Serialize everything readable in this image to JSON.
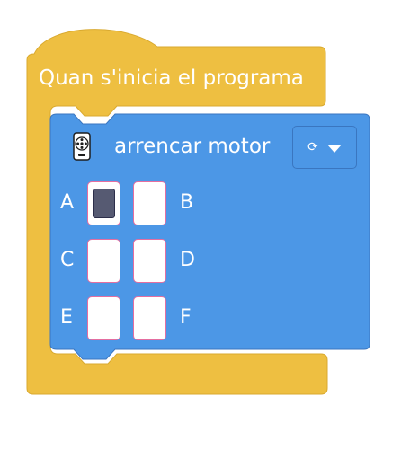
{
  "hat_block": {
    "label": "Quan s'inicia el programa",
    "color": "#eebf41"
  },
  "motor_block": {
    "label": "arrencar motor",
    "icon": "motor-icon",
    "color": "#4c97e6",
    "direction_dropdown": {
      "icon": "rotate-clockwise-icon",
      "glyph": "⟳"
    }
  },
  "ports": [
    {
      "name": "A",
      "selected": true
    },
    {
      "name": "B",
      "selected": false
    },
    {
      "name": "C",
      "selected": false
    },
    {
      "name": "D",
      "selected": false
    },
    {
      "name": "E",
      "selected": false
    },
    {
      "name": "F",
      "selected": false
    }
  ],
  "colors": {
    "port_selected": "#565a72",
    "port_border": "#e56ea0"
  }
}
